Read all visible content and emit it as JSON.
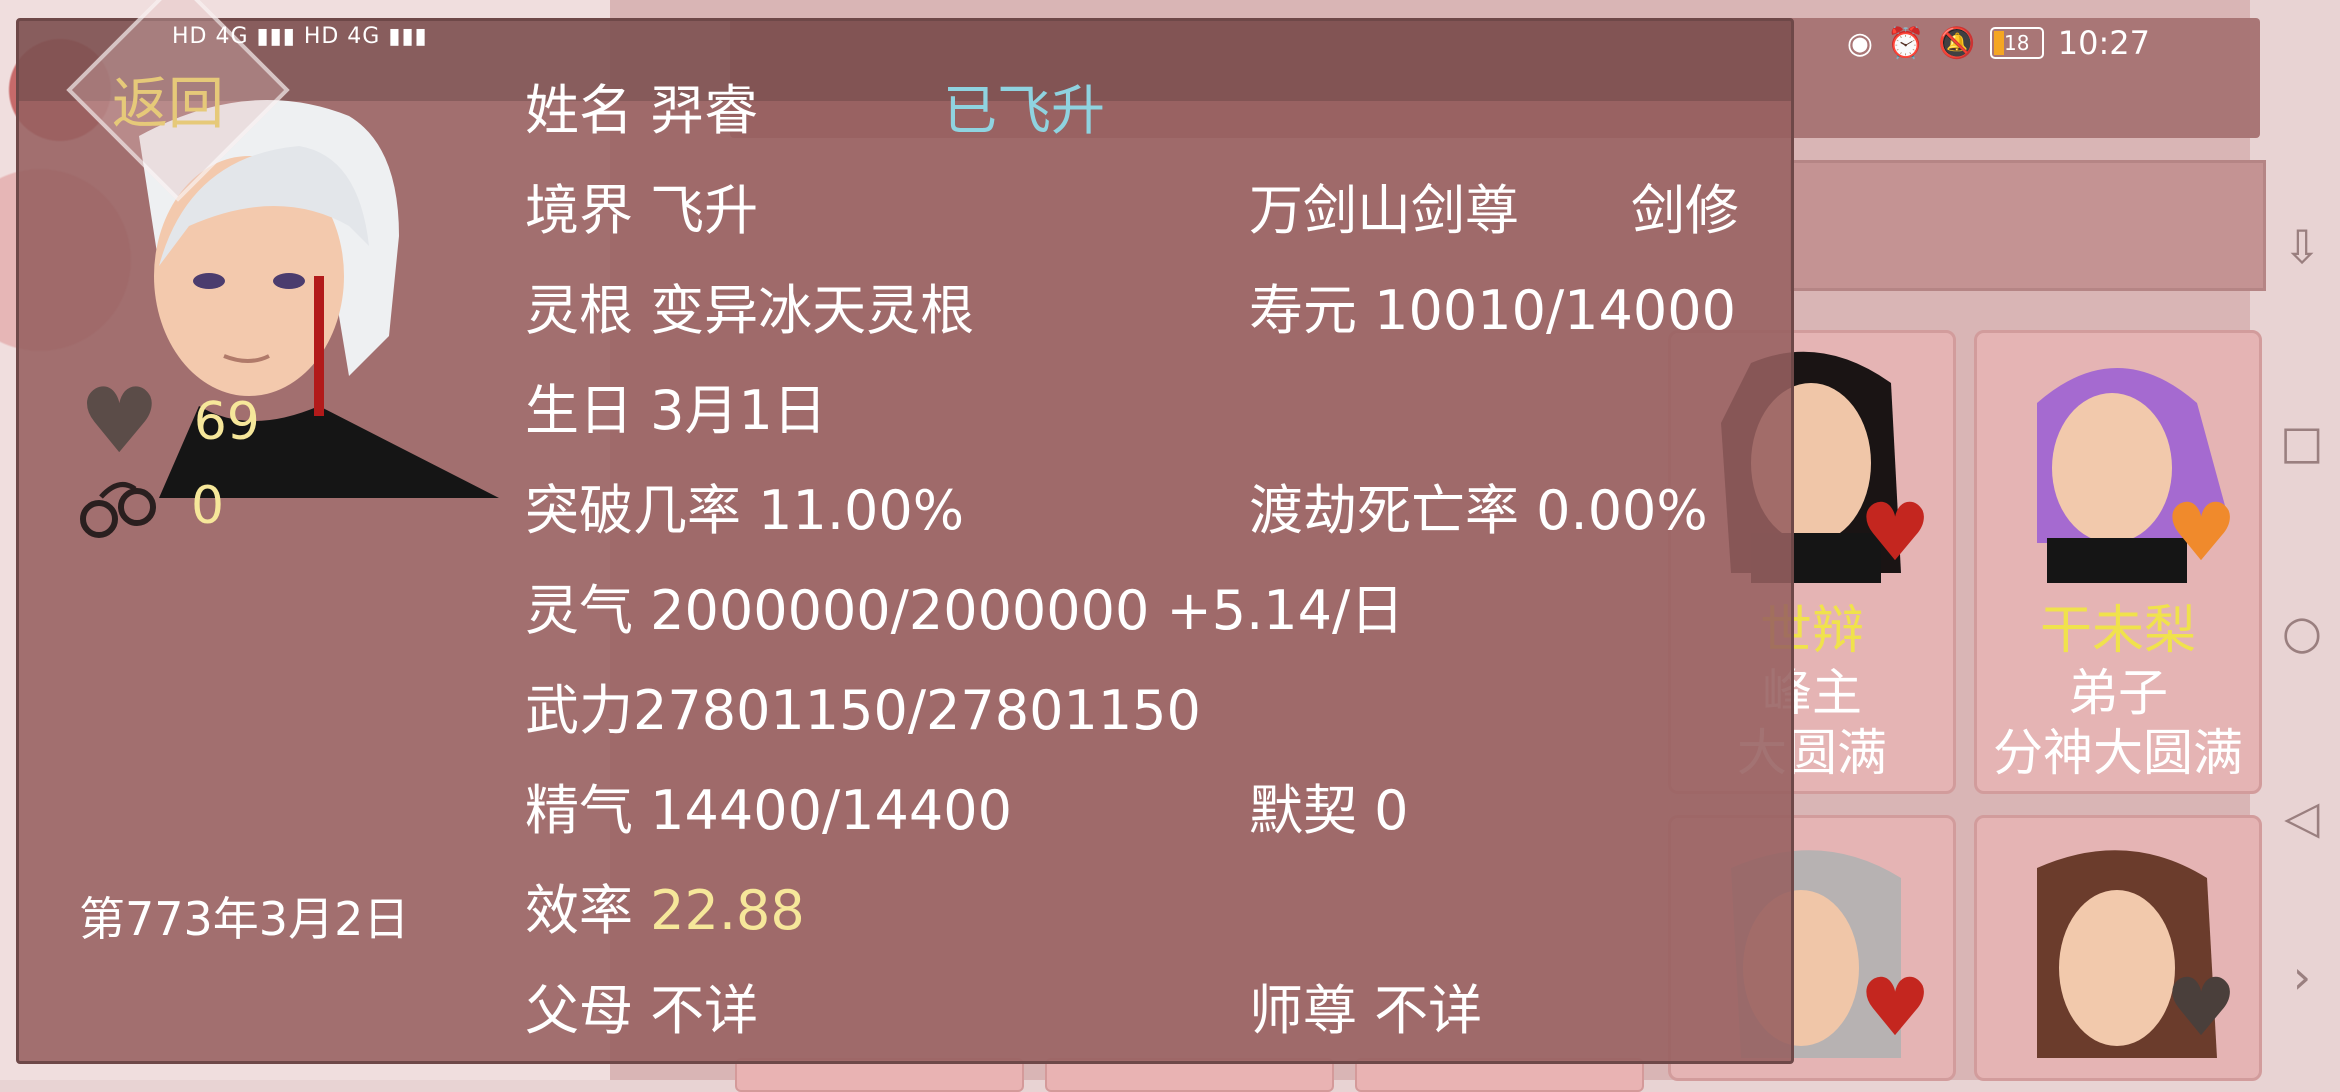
{
  "status_bar": {
    "left_indicators": "HD 4G ▮▮▮ HD 4G ▮▮▮",
    "time": "10:27",
    "battery": "18"
  },
  "back_label": "返回",
  "character": {
    "name_label": "姓名",
    "name": "羿睿",
    "status": "已飞升",
    "realm_label": "境界",
    "realm": "飞升",
    "title": "万剑山剑尊",
    "class": "剑修",
    "root_label": "灵根",
    "root": "变异冰天灵根",
    "lifespan_label": "寿元",
    "lifespan": "10010/14000",
    "birthday_label": "生日",
    "birthday": "3月1日",
    "breakthrough_label": "突破几率",
    "breakthrough": "11.00%",
    "tribulation_label": "渡劫死亡率",
    "tribulation": "0.00%",
    "qi_label": "灵气",
    "qi": "2000000/2000000 +5.14/日",
    "force_label": "武力",
    "force": "27801150/27801150",
    "essence_label": "精气",
    "essence": "14400/14400",
    "bond_label": "默契",
    "bond": "0",
    "efficiency_label": "效率",
    "efficiency": "22.88",
    "parents_label": "父母",
    "parents": "不详",
    "master_label": "师尊",
    "master": "不详"
  },
  "side_stats": {
    "affection": "69",
    "bonds": "0",
    "date": "第773年3月2日"
  },
  "cards": [
    {
      "name": "世辩",
      "role": "峰主",
      "realm": "大圆满",
      "heart_color": "#c4261f"
    },
    {
      "name": "干未梨",
      "role": "弟子",
      "realm": "分神大圆满",
      "heart_color": "#f08a2c"
    }
  ],
  "colors": {
    "panel": "#96605f",
    "highlight": "#f6e79a",
    "status_blue": "#8fd3e0"
  }
}
